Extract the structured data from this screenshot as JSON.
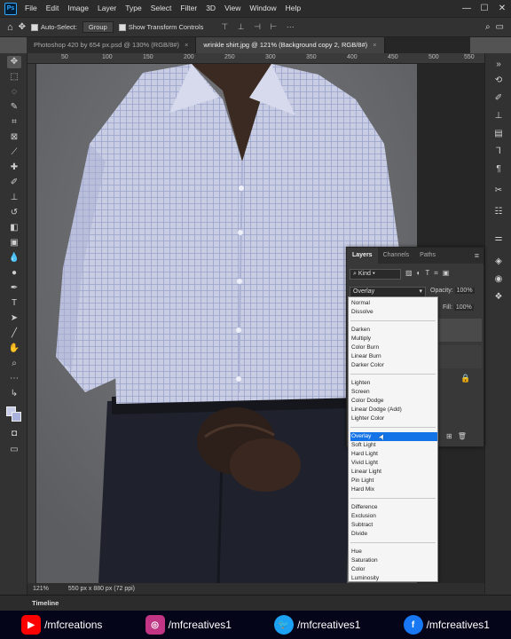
{
  "app": {
    "logo": "Ps"
  },
  "menu": [
    "File",
    "Edit",
    "Image",
    "Layer",
    "Type",
    "Select",
    "Filter",
    "3D",
    "View",
    "Window",
    "Help"
  ],
  "window_controls": {
    "minimize": "—",
    "maximize": "☐",
    "close": "✕"
  },
  "options_bar": {
    "auto_select_label": "Auto-Select:",
    "auto_select_value": "Group",
    "show_transform_label": "Show Transform Controls"
  },
  "doc_tabs": [
    {
      "label": "Photoshop 420 by 654 px.psd @ 130% (RGB/8#)",
      "close": "×"
    },
    {
      "label": "wrinkle shirt.jpg @ 121% (Background copy 2, RGB/8#)",
      "close": "×"
    }
  ],
  "ruler_top": [
    "50",
    "100",
    "150",
    "200",
    "250",
    "300",
    "350",
    "400",
    "450",
    "500",
    "550"
  ],
  "status": {
    "zoom": "121%",
    "doc_size": "550 px x 880 px (72 ppi)"
  },
  "timeline": {
    "label": "Timeline"
  },
  "layers_panel": {
    "tabs": [
      "Layers",
      "Channels",
      "Paths"
    ],
    "kind_label": "Kind",
    "blend_mode": "Overlay",
    "opacity_label": "Opacity:",
    "opacity_value": "100%",
    "fill_label": "Fill:",
    "fill_value": "100%"
  },
  "blend_menu": {
    "items": [
      "Normal",
      "Dissolve",
      "Darken",
      "Multiply",
      "Color Burn",
      "Linear Burn",
      "Darker Color",
      "Lighten",
      "Screen",
      "Color Dodge",
      "Linear Dodge (Add)",
      "Lighter Color",
      "Overlay",
      "Soft Light",
      "Hard Light",
      "Vivid Light",
      "Linear Light",
      "Pin Light",
      "Hard Mix",
      "Difference",
      "Exclusion",
      "Subtract",
      "Divide",
      "Hue",
      "Saturation",
      "Color",
      "Luminosity"
    ],
    "selected": "Overlay"
  },
  "social": [
    {
      "icon": "youtube-icon",
      "handle": "/mfcreations",
      "color": "#ff0000"
    },
    {
      "icon": "instagram-icon",
      "handle": "/mfcreatives1",
      "color": "#c13584"
    },
    {
      "icon": "twitter-icon",
      "handle": "/mfcreatives1",
      "color": "#1da1f2"
    },
    {
      "icon": "facebook-icon",
      "handle": "/mfcreatives1",
      "color": "#1877f2"
    }
  ],
  "colors": {
    "foreground": "#c7cce8",
    "background": "#a8b2dc",
    "selection": "#1473e6"
  }
}
